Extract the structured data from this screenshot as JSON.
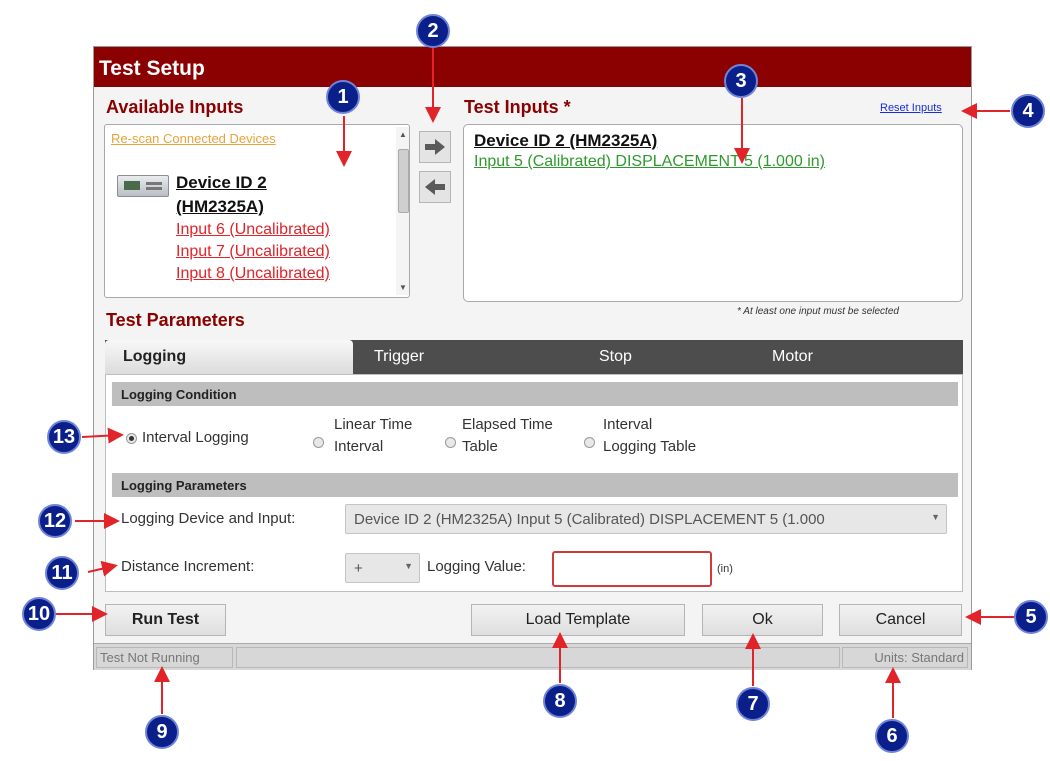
{
  "dialog": {
    "title": "Test Setup"
  },
  "available_inputs": {
    "title": "Available Inputs",
    "rescan_link": "Re-scan Connected Devices",
    "device_name_line1": "Device ID 2",
    "device_name_line2": "(HM2325A)",
    "inputs": [
      "Input 6 (Uncalibrated)",
      "Input 7 (Uncalibrated)",
      "Input 8 (Uncalibrated)"
    ]
  },
  "move_buttons": {
    "add_icon": "arrow-right-icon",
    "remove_icon": "arrow-left-icon"
  },
  "test_inputs": {
    "title": "Test Inputs *",
    "reset_link": "Reset Inputs",
    "device": "Device ID 2 (HM2325A)",
    "selected_input": "Input 5 (Calibrated) DISPLACEMENT 5 (1.000 in)",
    "hint": "* At least one input must be selected"
  },
  "test_parameters": {
    "title": "Test Parameters",
    "tabs": [
      "Logging",
      "Trigger",
      "Stop",
      "Motor"
    ],
    "active_tab": "Logging",
    "logging_condition": {
      "header": "Logging Condition",
      "options": [
        {
          "line1": "Interval Logging",
          "line2": ""
        },
        {
          "line1": "Linear Time",
          "line2": "Interval"
        },
        {
          "line1": "Elapsed Time",
          "line2": "Table"
        },
        {
          "line1": "Interval",
          "line2": "Logging Table"
        }
      ],
      "selected": "Interval Logging"
    },
    "logging_parameters": {
      "header": "Logging Parameters",
      "device_label": "Logging Device and Input:",
      "device_value": "Device ID 2 (HM2325A) Input 5 (Calibrated) DISPLACEMENT 5 (1.000",
      "distance_label": "Distance Increment:",
      "distance_value": "+",
      "logging_value_label": "Logging Value:",
      "logging_value": "",
      "unit": "(in)"
    }
  },
  "buttons": {
    "run_test": "Run Test",
    "load_template": "Load Template",
    "ok": "Ok",
    "cancel": "Cancel"
  },
  "status": {
    "state": "Test Not Running",
    "units": "Units: Standard"
  },
  "callouts": [
    "1",
    "2",
    "3",
    "4",
    "5",
    "6",
    "7",
    "8",
    "9",
    "10",
    "11",
    "12",
    "13"
  ],
  "colors": {
    "title_bar": "#8b0000",
    "accent_red": "#e0242a",
    "accent_green": "#2e9a2e",
    "callout": "#0a1f8a",
    "link_blue": "#1a2ed8"
  }
}
